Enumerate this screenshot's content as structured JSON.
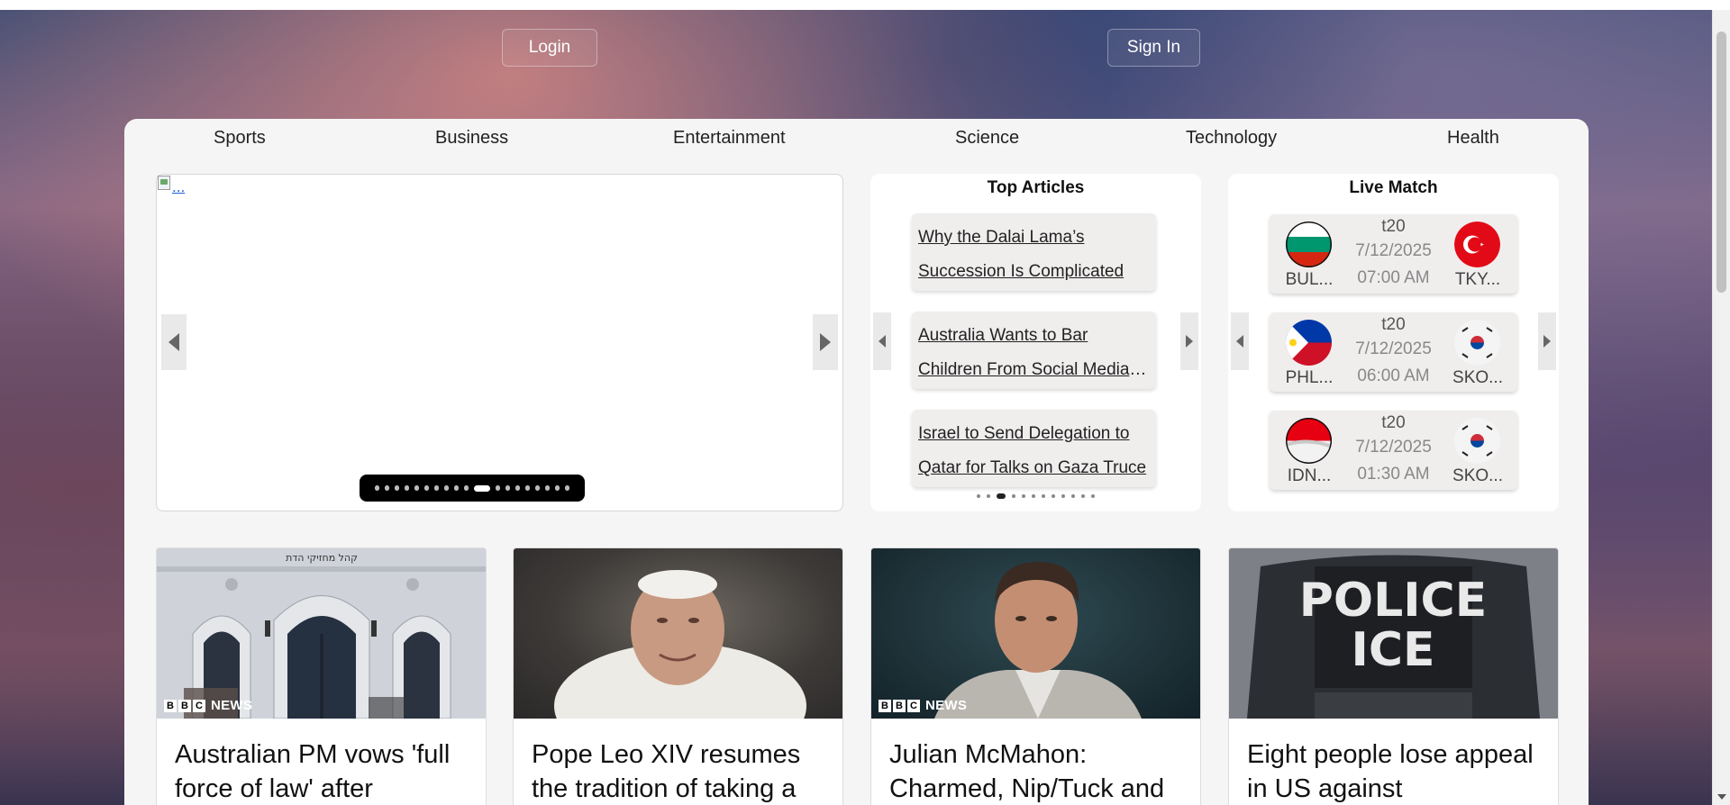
{
  "auth": {
    "login_label": "Login",
    "signin_label": "Sign In"
  },
  "nav": {
    "items": [
      {
        "label": "Sports"
      },
      {
        "label": "Business"
      },
      {
        "label": "Entertainment"
      },
      {
        "label": "Science"
      },
      {
        "label": "Technology"
      },
      {
        "label": "Health"
      }
    ]
  },
  "carousel": {
    "image_alt": "...",
    "indicator_count": 19,
    "active_index": 10
  },
  "top_articles": {
    "title": "Top Articles",
    "items": [
      {
        "title": "Why the Dalai Lama’s Succession Is Complicated"
      },
      {
        "title": "Australia Wants to Bar Children From Social Media Accounts"
      },
      {
        "title": "Israel to Send Delegation to Qatar for Talks on Gaza Truce"
      }
    ],
    "indicator_count": 12,
    "active_index": 2
  },
  "live_match": {
    "title": "Live Match",
    "matches": [
      {
        "format": "t20",
        "date": "7/12/2025",
        "time": "07:00 AM",
        "team1": "BUL...",
        "team2": "TKY..."
      },
      {
        "format": "t20",
        "date": "7/12/2025",
        "time": "06:00 AM",
        "team1": "PHL...",
        "team2": "SKO..."
      },
      {
        "format": "t20",
        "date": "7/12/2025",
        "time": "01:30 AM",
        "team1": "IDN...",
        "team2": "SKO..."
      }
    ]
  },
  "news_cards": [
    {
      "title": "Australian PM vows 'full force of law' after",
      "source": "NEWS",
      "has_bbc_tag": true
    },
    {
      "title": "Pope Leo XIV resumes the tradition of taking a",
      "source": "",
      "has_bbc_tag": false
    },
    {
      "title": "Julian McMahon: Charmed, Nip/Tuck and",
      "source": "NEWS",
      "has_bbc_tag": true
    },
    {
      "title": "Eight people lose appeal in US against",
      "source": "",
      "has_bbc_tag": false
    }
  ],
  "police_vest_text": {
    "line1": "POLICE",
    "line2": "ICE"
  },
  "synagogue_sign": "קהל מחזיקי הדת",
  "bbc_letters": [
    "B",
    "B",
    "C"
  ],
  "colors": {
    "panel_bg": "#f5f5f5",
    "carousel_indicator_bg": "#000000",
    "link_color": "#1a5fd6"
  }
}
